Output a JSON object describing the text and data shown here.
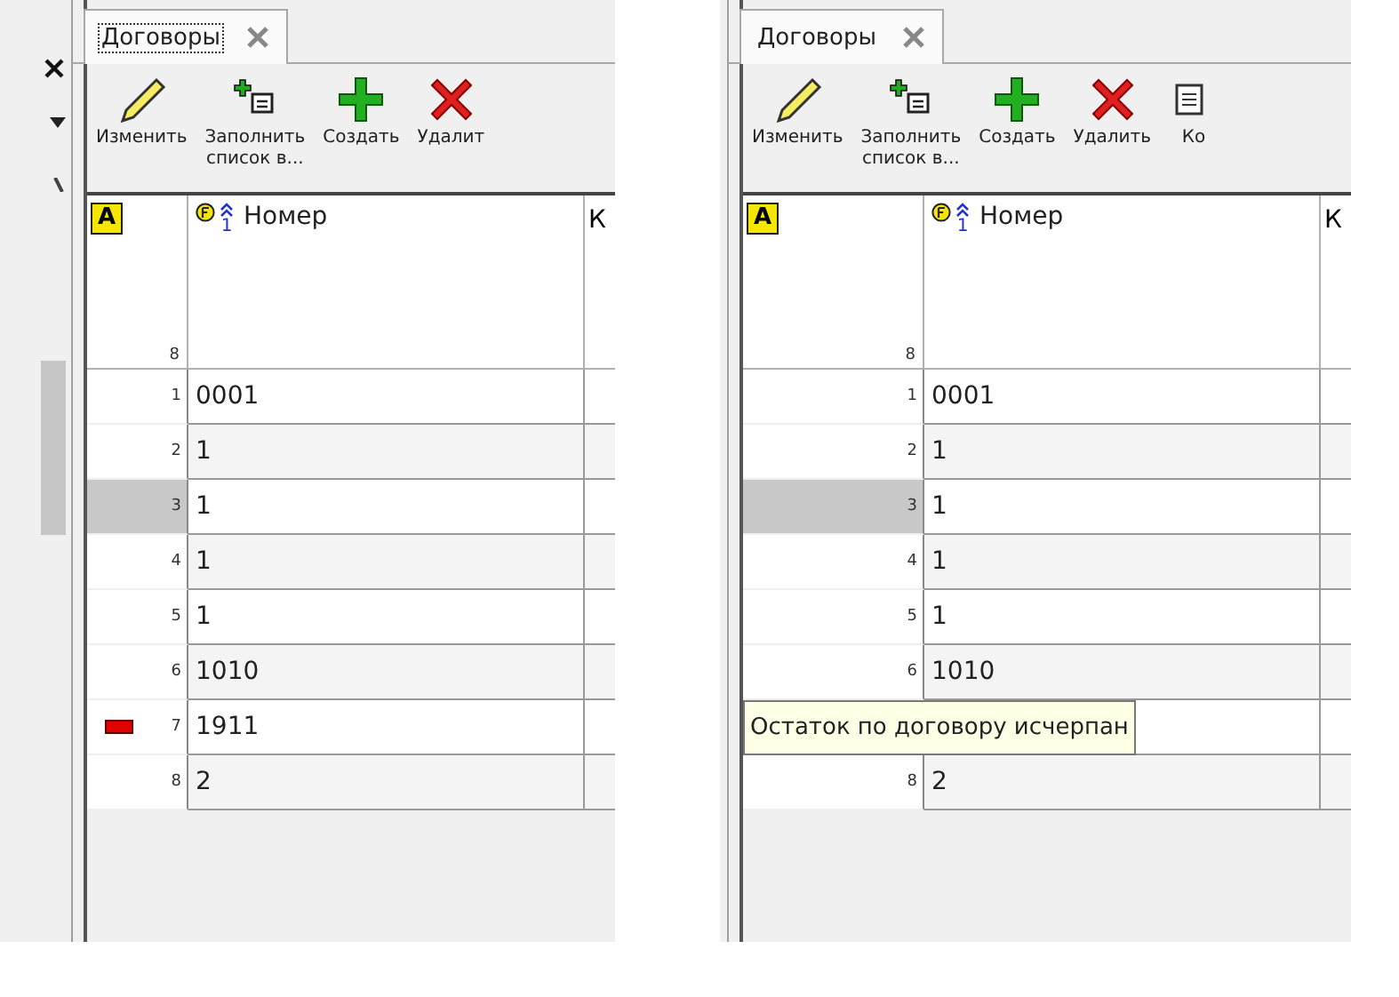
{
  "panels": [
    {
      "tab": {
        "label": "Договоры",
        "focused": true
      },
      "toolbar": [
        {
          "kind": "pencil",
          "label": "Изменить"
        },
        {
          "kind": "fill-list",
          "label": "Заполнить",
          "label2": "список в..."
        },
        {
          "kind": "plus",
          "label": "Создать"
        },
        {
          "kind": "cross",
          "label": "Удалит"
        }
      ],
      "grid": {
        "corner": "A",
        "count": "8",
        "columns": [
          {
            "label": "Номер",
            "sort": "1"
          },
          {
            "label": "К"
          }
        ],
        "rows": [
          {
            "number": "1",
            "value": "0001",
            "selected": false,
            "flag": false
          },
          {
            "number": "2",
            "value": "1",
            "selected": false,
            "flag": false
          },
          {
            "number": "3",
            "value": "1",
            "selected": true,
            "flag": false
          },
          {
            "number": "4",
            "value": "1",
            "selected": false,
            "flag": false
          },
          {
            "number": "5",
            "value": "1",
            "selected": false,
            "flag": false
          },
          {
            "number": "6",
            "value": "1010",
            "selected": false,
            "flag": false
          },
          {
            "number": "7",
            "value": "1911",
            "selected": false,
            "flag": true
          },
          {
            "number": "8",
            "value": "2",
            "selected": false,
            "flag": false
          }
        ]
      }
    },
    {
      "tab": {
        "label": "Договоры",
        "focused": false
      },
      "toolbar": [
        {
          "kind": "pencil",
          "label": "Изменить"
        },
        {
          "kind": "fill-list",
          "label": "Заполнить",
          "label2": "список в..."
        },
        {
          "kind": "plus",
          "label": "Создать"
        },
        {
          "kind": "cross",
          "label": "Удалить"
        },
        {
          "kind": "doc",
          "label": "Ко"
        }
      ],
      "grid": {
        "corner": "A",
        "count": "8",
        "columns": [
          {
            "label": "Номер",
            "sort": "1"
          },
          {
            "label": "К"
          }
        ],
        "rows": [
          {
            "number": "1",
            "value": "0001",
            "selected": false,
            "flag": false
          },
          {
            "number": "2",
            "value": "1",
            "selected": false,
            "flag": false
          },
          {
            "number": "3",
            "value": "1",
            "selected": true,
            "flag": false
          },
          {
            "number": "4",
            "value": "1",
            "selected": false,
            "flag": false
          },
          {
            "number": "5",
            "value": "1",
            "selected": false,
            "flag": false
          },
          {
            "number": "6",
            "value": "1010",
            "selected": false,
            "flag": false
          },
          {
            "tooltip": "Остаток по договору исчерпан"
          },
          {
            "number": "8",
            "value": "2",
            "selected": false,
            "flag": false
          }
        ]
      }
    }
  ]
}
